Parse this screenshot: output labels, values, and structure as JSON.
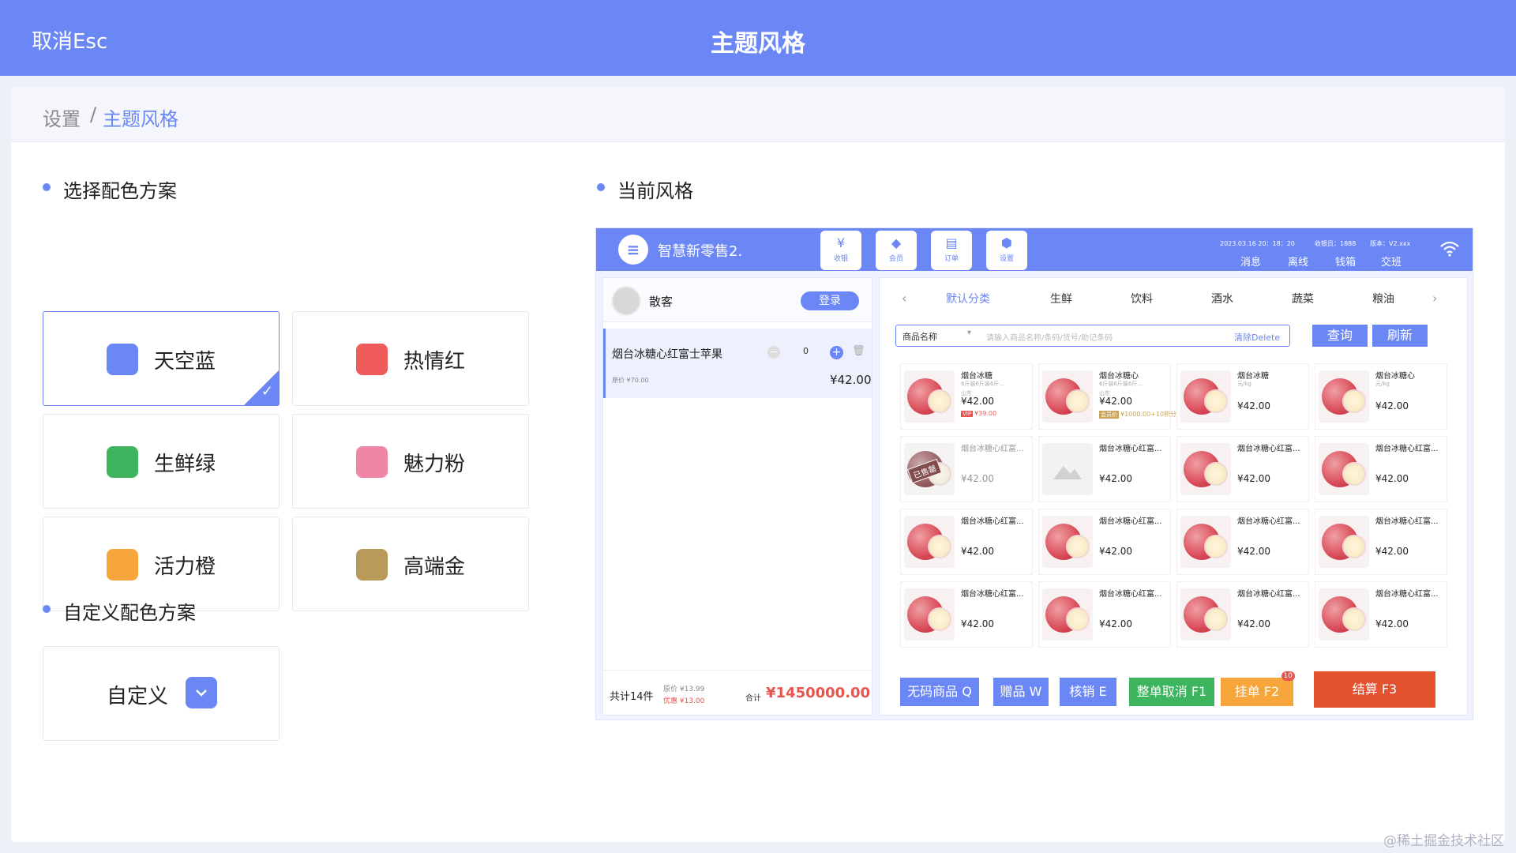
{
  "header": {
    "cancel_label": "取消Esc",
    "title": "主题风格"
  },
  "breadcrumb": {
    "parent": "设置",
    "separator": "/",
    "current": "主题风格"
  },
  "scheme_section": {
    "title": "选择配色方案",
    "options": [
      {
        "label": "天空蓝",
        "color": "#6b86f5",
        "selected": true
      },
      {
        "label": "热情红",
        "color": "#f05b5b",
        "selected": false
      },
      {
        "label": "生鲜绿",
        "color": "#3cb55e",
        "selected": false
      },
      {
        "label": "魅力粉",
        "color": "#ef86a6",
        "selected": false
      },
      {
        "label": "活力橙",
        "color": "#f7a63c",
        "selected": false
      },
      {
        "label": "高端金",
        "color": "#b99a5a",
        "selected": false
      }
    ]
  },
  "custom_section": {
    "title": "自定义配色方案",
    "label": "自定义",
    "dropdown_icon": "chevron-down-icon"
  },
  "preview_section": {
    "title": "当前风格"
  },
  "preview": {
    "app_name": "智慧新零售2.",
    "quick_buttons": [
      {
        "label": "收银",
        "icon": "cashier-icon",
        "glyph": "¥"
      },
      {
        "label": "会员",
        "icon": "diamond-icon",
        "glyph": "◆"
      },
      {
        "label": "订单",
        "icon": "order-icon",
        "glyph": "▤"
      },
      {
        "label": "设置",
        "icon": "settings-icon",
        "glyph": "⬢"
      }
    ],
    "status": {
      "datetime": "2023.03.16 20：18：20",
      "cashier": "收银员：1888",
      "version": "版本：V2.xxx"
    },
    "menu_links": [
      "消息",
      "离线",
      "钱箱",
      "交班"
    ],
    "customer": {
      "name": "散客",
      "login_label": "登录"
    },
    "cart_item": {
      "name": "烟台冰糖心红富士苹果",
      "original_price": "原价 ¥70.00",
      "quantity": "0",
      "price": "¥42.00"
    },
    "cart_footer": {
      "count": "共计14件",
      "original": "原价 ¥13.99",
      "discount": "优惠 ¥13.00",
      "total_label": "合计",
      "total": "¥1450000.00"
    },
    "categories": [
      "默认分类",
      "生鲜",
      "饮料",
      "酒水",
      "蔬菜",
      "粮油"
    ],
    "search": {
      "field": "商品名称",
      "placeholder": "请输入商品名称/条码/货号/助记条码",
      "clear_label": "清除Delete",
      "query_label": "查询",
      "refresh_label": "刷新"
    },
    "products": [
      {
        "name": "烟台冰糖",
        "spec": "6斤装6斤装6斤...",
        "spec2": "山东",
        "price": "¥42.00",
        "sub_tag": "VIP",
        "sub_text": "¥39.00",
        "style": "apple"
      },
      {
        "name": "烟台冰糖心",
        "spec": "6斤装6斤装6斤...",
        "spec2": "山东",
        "price": "¥42.00",
        "sub_tag": "会员价",
        "sub_text": "¥1000.00+10积分",
        "style": "apple"
      },
      {
        "name": "烟台冰糖",
        "spec": "元/kg",
        "price": "¥42.00",
        "style": "apple"
      },
      {
        "name": "烟台冰糖心",
        "spec": "元/kg",
        "price": "¥42.00",
        "style": "apple"
      },
      {
        "name": "烟台冰糖心红富...",
        "price": "¥42.00",
        "style": "sold",
        "sold_label": "已售罄"
      },
      {
        "name": "烟台冰糖心红富...",
        "price": "¥42.00",
        "style": "placeholder"
      },
      {
        "name": "烟台冰糖心红富...",
        "price": "¥42.00",
        "style": "apple"
      },
      {
        "name": "烟台冰糖心红富...",
        "price": "¥42.00",
        "style": "apple"
      },
      {
        "name": "烟台冰糖心红富...",
        "price": "¥42.00",
        "style": "apple"
      },
      {
        "name": "烟台冰糖心红富...",
        "price": "¥42.00",
        "style": "apple"
      },
      {
        "name": "烟台冰糖心红富...",
        "price": "¥42.00",
        "style": "apple"
      },
      {
        "name": "烟台冰糖心红富...",
        "price": "¥42.00",
        "style": "apple"
      },
      {
        "name": "烟台冰糖心红富...",
        "price": "¥42.00",
        "style": "apple"
      },
      {
        "name": "烟台冰糖心红富...",
        "price": "¥42.00",
        "style": "apple"
      },
      {
        "name": "烟台冰糖心红富...",
        "price": "¥42.00",
        "style": "apple"
      },
      {
        "name": "烟台冰糖心红富...",
        "price": "¥42.00",
        "style": "apple"
      }
    ],
    "footer_buttons": [
      {
        "label": "无码商品 Q",
        "color": "#6b86f5"
      },
      {
        "label": "赠品 W",
        "color": "#6b86f5"
      },
      {
        "label": "核销 E",
        "color": "#6b86f5"
      },
      {
        "label": "整单取消 F1",
        "color": "#3cb55e"
      },
      {
        "label": "挂单 F2",
        "color": "#f7a63c",
        "badge": "10"
      },
      {
        "label": "结算 F3",
        "color": "#e4522f"
      }
    ]
  },
  "watermark": "@稀土掘金技术社区"
}
